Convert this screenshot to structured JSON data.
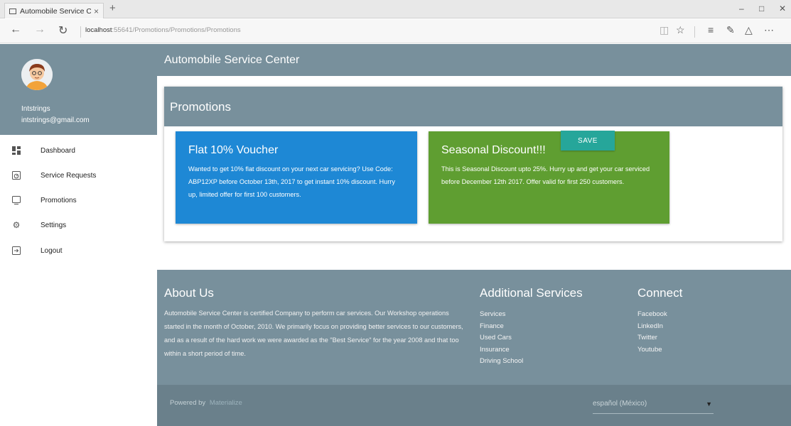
{
  "browser": {
    "tab_title": "Automobile Service Cen",
    "tab_close": "×",
    "new_tab": "+",
    "url_host": "localhost",
    "url_rest": ":55641/Promotions/Promotions/Promotions",
    "icons": [
      "back-arrow-icon",
      "forward-arrow-icon",
      "refresh-icon",
      "reading-view-icon",
      "favorite-star-icon",
      "hub-icon",
      "web-note-icon",
      "share-icon",
      "more-icon"
    ]
  },
  "sidebar": {
    "user_name": "Intstrings",
    "user_email": "intstrings@gmail.com",
    "items": [
      {
        "label": "Dashboard",
        "icon": "dashboard-icon"
      },
      {
        "label": "Service Requests",
        "icon": "service-requests-icon"
      },
      {
        "label": "Promotions",
        "icon": "promotions-icon"
      },
      {
        "label": "Settings",
        "icon": "gear-icon"
      },
      {
        "label": "Logout",
        "icon": "logout-icon"
      }
    ]
  },
  "header": {
    "title": "Automobile Service Center"
  },
  "promotions": {
    "title": "Promotions",
    "cards": [
      {
        "title": "Flat 10% Voucher",
        "text": "Wanted to get 10% flat discount on your next car servicing? Use Code: ABP12XP before October 13th, 2017 to get instant 10% discount. Hurry up, limited offer for first 100 customers.",
        "color": "#1e88d5"
      },
      {
        "title": "Seasonal Discount!!!",
        "text": "This is Seasonal Discount upto 25%. Hurry up and get your car serviced before December 12th 2017. Offer valid for first 250 customers.",
        "color": "#5f9e31"
      }
    ]
  },
  "footer": {
    "about_title": "About Us",
    "about_text": "Automobile Service Center is certified Company to perform car services. Our Workshop operations started in the month of October, 2010. We primarily focus on providing better services to our customers, and as a result of the hard work we were awarded as the \"Best Service\" for the year 2008 and that too within a short period of time.",
    "services_title": "Additional Services",
    "services": [
      "Services",
      "Finance",
      "Used Cars",
      "Insurance",
      "Driving School"
    ],
    "connect_title": "Connect",
    "connect": [
      "Facebook",
      "LinkedIn",
      "Twitter",
      "Youtube"
    ],
    "powered_by": "Powered by",
    "powered_brand": "Materialize",
    "language": "español (México)",
    "save_label": "SAVE"
  },
  "colors": {
    "header_bg": "#78909c",
    "save_button": "#26a69a"
  }
}
